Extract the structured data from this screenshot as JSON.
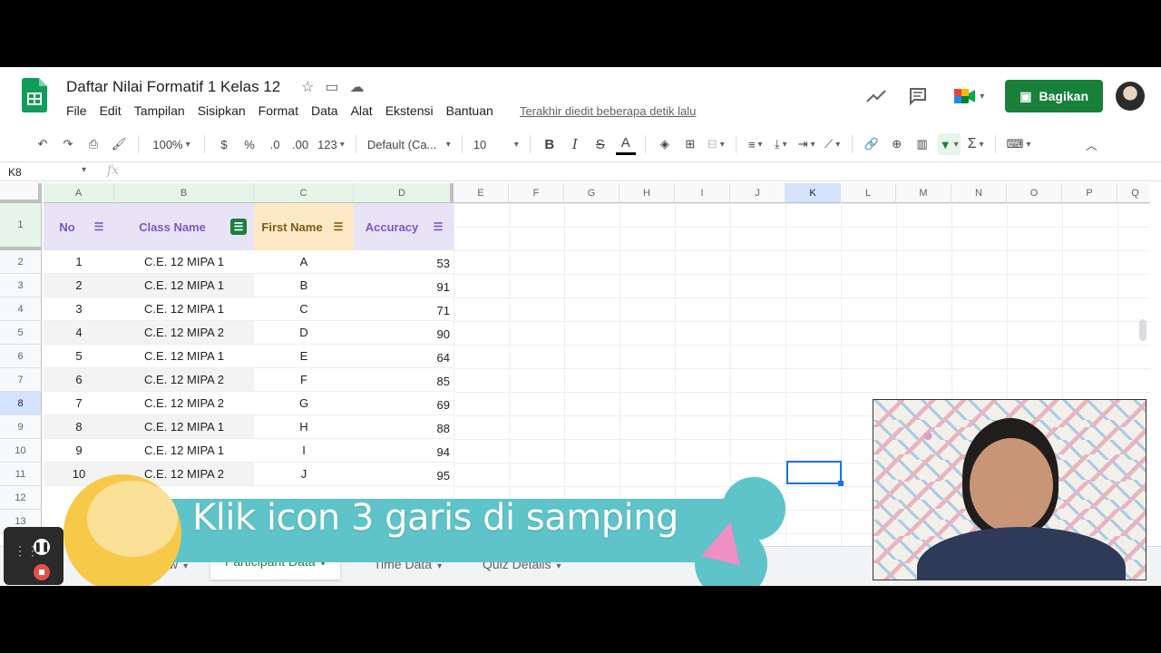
{
  "title": {
    "doc_title": "Daftar Nilai Formatif 1 Kelas 12",
    "last_edit": "Terakhir diedit beberapa detik lalu",
    "share_label": "Bagikan"
  },
  "menu": [
    "File",
    "Edit",
    "Tampilan",
    "Sisipkan",
    "Format",
    "Data",
    "Alat",
    "Ekstensi",
    "Bantuan"
  ],
  "toolbar": {
    "zoom": "100%",
    "currency": "$",
    "percent": "%",
    "decimal_dec": ".0",
    "decimal_inc": ".00",
    "more_formats": "123",
    "font": "Default (Ca...",
    "font_size": "10"
  },
  "formula_bar": {
    "name_box": "K8",
    "fx": "fx"
  },
  "columns": [
    "A",
    "B",
    "C",
    "D",
    "E",
    "F",
    "G",
    "H",
    "I",
    "J",
    "K",
    "L",
    "M",
    "N",
    "O",
    "P",
    "Q"
  ],
  "row_numbers": [
    "1",
    "2",
    "3",
    "4",
    "5",
    "6",
    "7",
    "8",
    "9",
    "10",
    "11",
    "12",
    "13"
  ],
  "headers": [
    "No",
    "Class Name",
    "First Name",
    "Accuracy"
  ],
  "rows": [
    [
      "1",
      "C.E. 12 MIPA 1",
      "A",
      "53"
    ],
    [
      "2",
      "C.E. 12 MIPA 1",
      "B",
      "91"
    ],
    [
      "3",
      "C.E. 12 MIPA 1",
      "C",
      "71"
    ],
    [
      "4",
      "C.E. 12 MIPA 2",
      "D",
      "90"
    ],
    [
      "5",
      "C.E. 12 MIPA 1",
      "E",
      "64"
    ],
    [
      "6",
      "C.E. 12 MIPA 2",
      "F",
      "85"
    ],
    [
      "7",
      "C.E. 12 MIPA 2",
      "G",
      "69"
    ],
    [
      "8",
      "C.E. 12 MIPA 1",
      "H",
      "88"
    ],
    [
      "9",
      "C.E. 12 MIPA 1",
      "I",
      "94"
    ],
    [
      "10",
      "C.E. 12 MIPA 2",
      "J",
      "95"
    ]
  ],
  "sheets": {
    "partial": "w",
    "active": "Participant Data",
    "second": "Time Data",
    "third": "Quiz Details"
  },
  "caption": "Klik icon 3 garis di samping",
  "colors": {
    "accent_green": "#188038",
    "header_purple": "#7e57c2",
    "header_orange_bg": "#fde9c5",
    "header_purple_bg": "#e9e3f6"
  }
}
